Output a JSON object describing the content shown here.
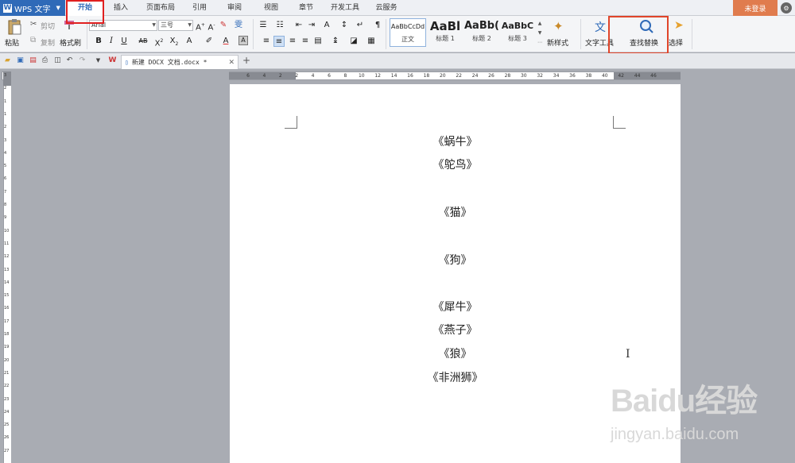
{
  "app": {
    "name": "WPS 文字"
  },
  "tabs": [
    {
      "label": "开始",
      "active": true
    },
    {
      "label": "插入"
    },
    {
      "label": "页面布局"
    },
    {
      "label": "引用"
    },
    {
      "label": "审阅"
    },
    {
      "label": "视图"
    },
    {
      "label": "章节"
    },
    {
      "label": "开发工具"
    },
    {
      "label": "云服务"
    }
  ],
  "account": {
    "login_label": "未登录"
  },
  "ribbon": {
    "paste": "粘贴",
    "cut": "剪切",
    "copy": "复制",
    "format_painter": "格式刷",
    "font_name": "Arial",
    "font_size": "三号",
    "styles": [
      {
        "sample": "AaBbCcDd",
        "name": "正文"
      },
      {
        "sample": "AaBl",
        "name": "标题 1"
      },
      {
        "sample": "AaBb(",
        "name": "标题 2"
      },
      {
        "sample": "AaBbC",
        "name": "标题 3"
      }
    ],
    "new_style": "新样式",
    "text_tools": "文字工具",
    "find_replace": "查找替换",
    "select": "选择"
  },
  "document": {
    "tab_title": "新建 DOCX 文档.docx *",
    "lines": [
      "《蜗牛》",
      "《鸵鸟》",
      "《猫》",
      "《狗》",
      "《犀牛》",
      "《燕子》",
      "《狼》",
      "《非洲狮》"
    ]
  },
  "ruler": {
    "horizontal_labels": [
      "6",
      "4",
      "2",
      "2",
      "4",
      "6",
      "8",
      "10",
      "12",
      "14",
      "16",
      "18",
      "20",
      "22",
      "24",
      "26",
      "28",
      "30",
      "32",
      "34",
      "36",
      "38",
      "40",
      "42",
      "44",
      "46"
    ],
    "vertical_labels": [
      "3",
      "2",
      "1",
      "1",
      "2",
      "3",
      "4",
      "5",
      "6",
      "7",
      "8",
      "9",
      "10",
      "11",
      "12",
      "13",
      "14",
      "15",
      "16",
      "17",
      "18",
      "19",
      "20",
      "21",
      "22",
      "23",
      "24",
      "25",
      "26",
      "27"
    ]
  },
  "watermark": {
    "brand": "Baidu经验",
    "url": "jingyan.baidu.com"
  },
  "colors": {
    "accent": "#2f6ab8",
    "highlight_red": "#e02020",
    "login_orange": "#e07c4e"
  }
}
